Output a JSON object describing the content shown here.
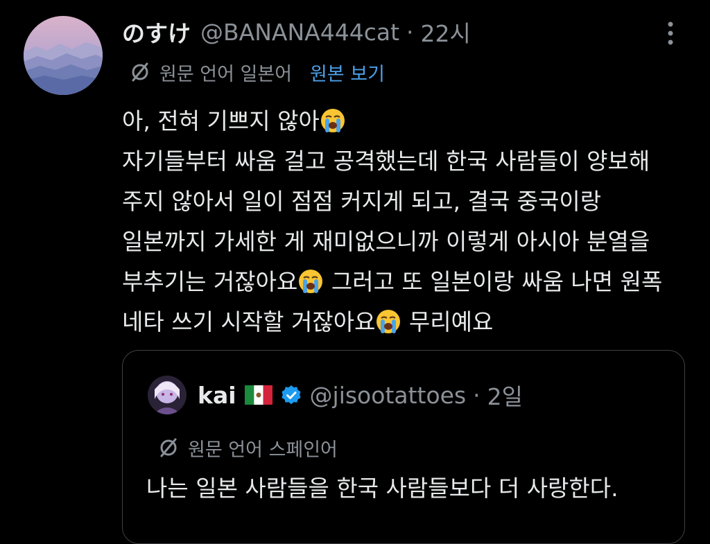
{
  "tweet": {
    "display_name": "のすけ",
    "handle": "@BANANA444cat",
    "separator": "·",
    "time": "22시",
    "translation": {
      "language_label": "원문 언어 일본어",
      "view_original": "원본 보기"
    },
    "lines": [
      {
        "text": "아, 전혀 기쁘지 않아",
        "emoji_after": "loudly-crying-face"
      },
      {
        "text": "자기들부터 싸움 걸고 공격했는데 한국 사람들이 양보해"
      },
      {
        "text": "주지 않아서 일이 점점 커지게 되고, 결국 중국이랑"
      },
      {
        "text": "일본까지 가세한 게 재미없으니까 이렇게 아시아 분열을"
      },
      {
        "text_a": "부추기는 거잖아요",
        "emoji": "loudly-crying-face",
        "text_b": " 그러고 또 일본이랑 싸움 나면 원폭"
      },
      {
        "text_a": "네타 쓰기 시작할 거잖아요",
        "emoji": "loudly-crying-face",
        "text_b": " 무리예요"
      }
    ],
    "avatar_icon": "mountain-landscape-avatar",
    "more_icon": "vertical-ellipsis-icon"
  },
  "quoted_tweet": {
    "display_name": "kai",
    "flag_icon": "mexico-flag-icon",
    "verified_icon": "verified-badge-icon",
    "handle": "@jisootattoes",
    "separator": "·",
    "time": "2일",
    "translation": {
      "language_label": "원문 언어 스페인어"
    },
    "text": "나는 일본 사람들을 한국 사람들보다 더 사랑한다."
  },
  "colors": {
    "background": "#000000",
    "primary_text": "#e7e9ea",
    "secondary_text": "#8b9198",
    "link": "#4da0e8",
    "verified": "#1d9bf0",
    "card_border": "#3e4144"
  }
}
